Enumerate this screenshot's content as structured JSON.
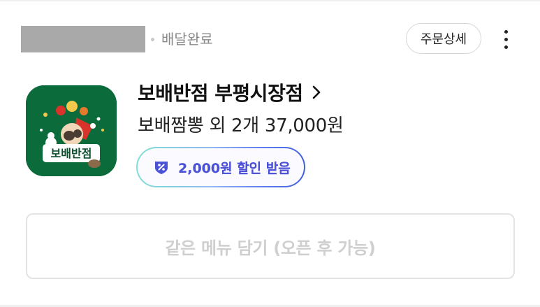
{
  "order": {
    "status": "배달완료",
    "detail_button": "주문상세",
    "more_icon": "more-vertical-icon"
  },
  "store": {
    "name": "보배반점 부평시장점",
    "logo_text": "보배반점",
    "order_summary": "보배짬뽕 외 2개 37,000원"
  },
  "coupon": {
    "label": "2,000원 할인 받음",
    "icon": "discount-coupon-icon"
  },
  "reorder": {
    "label": "같은 메뉴 담기 (오픈 후 가능)"
  },
  "colors": {
    "logo_bg": "#0b6b3b",
    "coupon_gradient_start": "#7fe0d4",
    "coupon_gradient_end": "#3f5fdf",
    "coupon_text": "#4b52d8",
    "disabled_text": "#cfcfcf"
  }
}
